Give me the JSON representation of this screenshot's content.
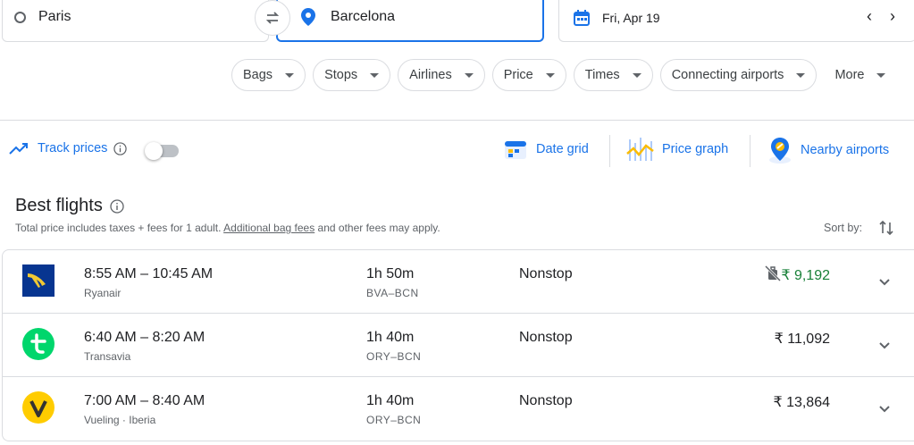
{
  "search": {
    "origin": "Paris",
    "destination": "Barcelona",
    "date": "Fri, Apr 19"
  },
  "filters": [
    "Bags",
    "Stops",
    "Airlines",
    "Price",
    "Times",
    "Connecting airports",
    "More"
  ],
  "tools": {
    "track_prices": "Track prices",
    "date_grid": "Date grid",
    "price_graph": "Price graph",
    "nearby_airports": "Nearby airports"
  },
  "section": {
    "title": "Best flights",
    "note_prefix": "Total price includes taxes + fees for 1 adult. ",
    "note_link": "Additional bag fees",
    "note_suffix": " and other fees may apply.",
    "sort_label": "Sort by:"
  },
  "colors": {
    "accent": "#1a73e8",
    "cheap_price": "#188038",
    "ryanair": "#073590",
    "transavia": "#00d66c",
    "vueling": "#ffcc00"
  },
  "flights": [
    {
      "times": "8:55 AM – 10:45 AM",
      "airline": "Ryanair",
      "duration": "1h 50m",
      "route": "BVA–BCN",
      "stops": "Nonstop",
      "price": "₹ 9,192",
      "logo": "ryanair-logo"
    },
    {
      "times": "6:40 AM – 8:20 AM",
      "airline": "Transavia",
      "duration": "1h 40m",
      "route": "ORY–BCN",
      "stops": "Nonstop",
      "price": "₹ 11,092",
      "logo": "transavia-logo"
    },
    {
      "times": "7:00 AM – 8:40 AM",
      "airline": "Vueling · Iberia",
      "duration": "1h 40m",
      "route": "ORY–BCN",
      "stops": "Nonstop",
      "price": "₹ 13,864",
      "logo": "vueling-logo"
    }
  ]
}
